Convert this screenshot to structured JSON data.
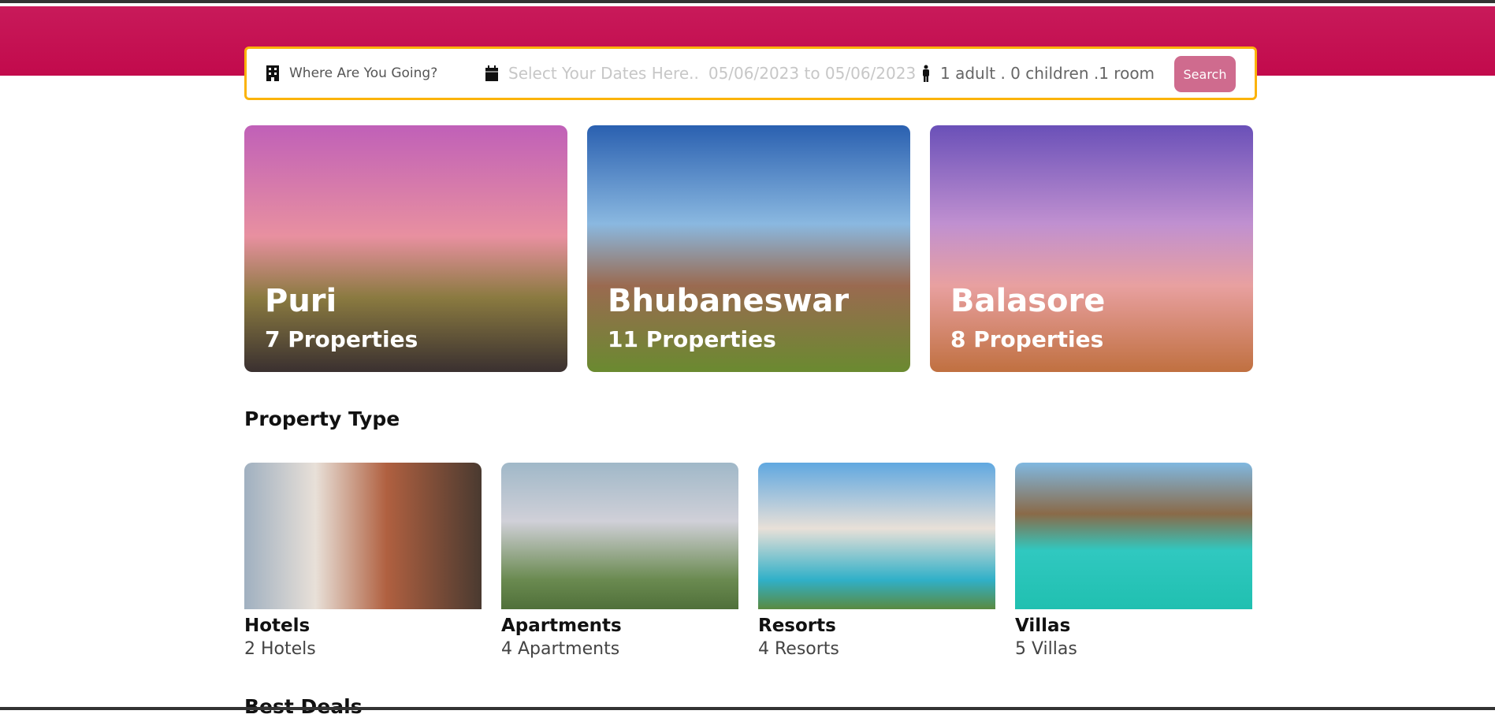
{
  "search": {
    "destination_placeholder": "Where Are You Going?",
    "dates_placeholder": "Select Your Dates Here..",
    "dates_value": "05/06/2023 to 05/06/2023",
    "occupancy": "1 adult . 0 children .1 room",
    "button": "Search"
  },
  "cities": [
    {
      "name": "Puri",
      "properties": "7 Properties"
    },
    {
      "name": "Bhubaneswar",
      "properties": "11 Properties"
    },
    {
      "name": "Balasore",
      "properties": "8 Properties"
    }
  ],
  "property_type": {
    "heading": "Property Type",
    "items": [
      {
        "title": "Hotels",
        "count": "2 Hotels"
      },
      {
        "title": "Apartments",
        "count": "4 Apartments"
      },
      {
        "title": "Resorts",
        "count": "4 Resorts"
      },
      {
        "title": "Villas",
        "count": "5 Villas"
      }
    ]
  },
  "best_deals": {
    "heading": "Best Deals"
  },
  "colors": {
    "header": "#c81a5a",
    "search_border": "#fbb30a",
    "search_button": "#cf6b8e"
  }
}
